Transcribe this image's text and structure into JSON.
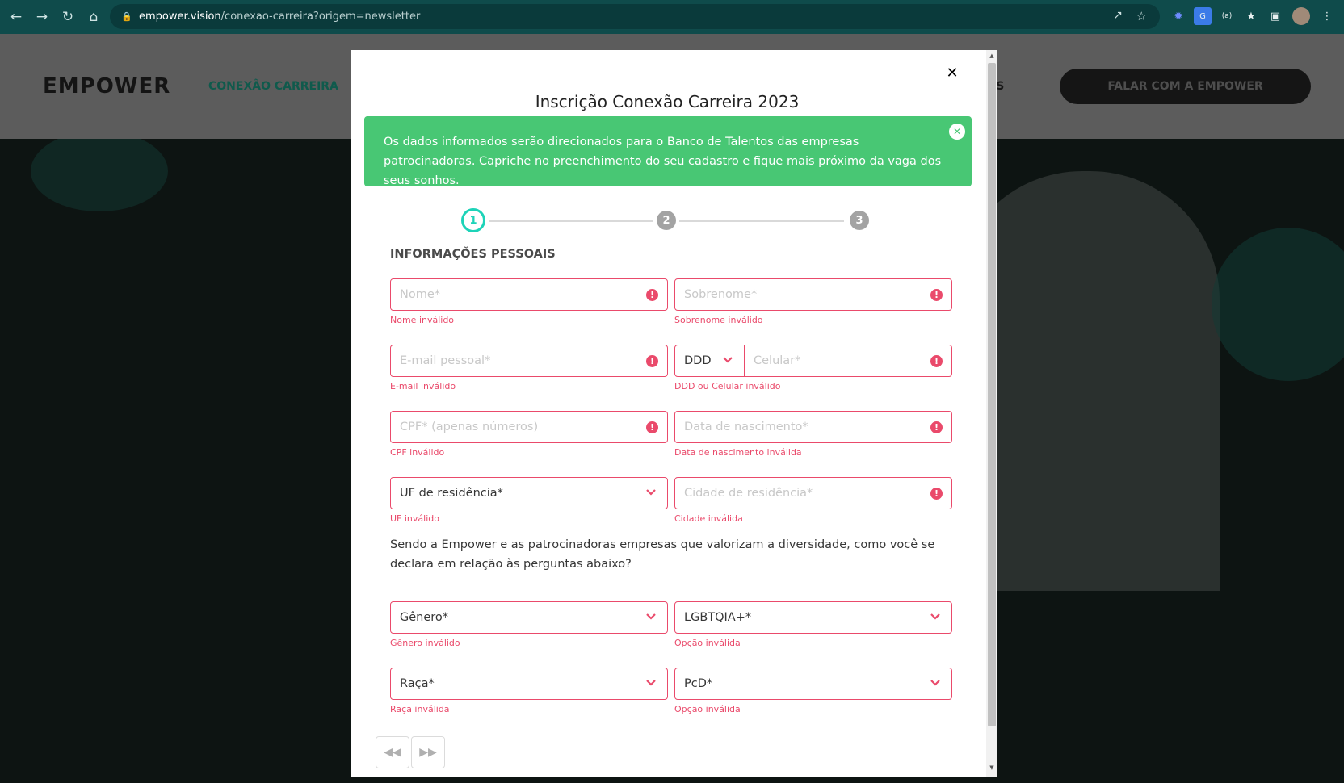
{
  "browser": {
    "url_host": "empower.vision",
    "url_path": "/conexao-carreira?origem=newsletter"
  },
  "site": {
    "logo": "EMPOWER",
    "nav_item": "CONEXÃO CARREIRA",
    "nav_item_right": "IS",
    "cta": "FALAR COM A EMPOWER"
  },
  "modal": {
    "title": "Inscrição Conexão Carreira 2023",
    "alert_text": "Os dados informados serão direcionados para o Banco de Talentos das empresas patrocinadoras. Capriche no preenchimento do seu cadastro e fique mais próximo da vaga dos seus sonhos.",
    "steps": [
      "1",
      "2",
      "3"
    ],
    "section_title": "INFORMAÇÕES PESSOAIS",
    "fields": {
      "nome": {
        "placeholder": "Nome*",
        "error": "Nome inválido"
      },
      "sobrenome": {
        "placeholder": "Sobrenome*",
        "error": "Sobrenome inválido"
      },
      "email": {
        "placeholder": "E-mail pessoal*",
        "error": "E-mail inválido"
      },
      "ddd": {
        "value": "DDD"
      },
      "celular": {
        "placeholder": "Celular*",
        "error": "DDD ou Celular inválido"
      },
      "cpf": {
        "placeholder": "CPF* (apenas números)",
        "error": "CPF inválido"
      },
      "nascimento": {
        "placeholder": "Data de nascimento*",
        "error": "Data de nascimento inválida"
      },
      "uf": {
        "value": "UF de residência*",
        "error": "UF inválido"
      },
      "cidade": {
        "placeholder": "Cidade de residência*",
        "error": "Cidade inválida"
      },
      "genero": {
        "value": "Gênero*",
        "error": "Gênero inválido"
      },
      "lgbt": {
        "value": "LGBTQIA+*",
        "error": "Opção inválida"
      },
      "raca": {
        "value": "Raça*",
        "error": "Raça inválida"
      },
      "pcd": {
        "value": "PcD*",
        "error": "Opção inválida"
      }
    },
    "diversity_question": "Sendo a Empower e as patrocinadoras empresas que valorizam a diversidade, como você se declara em relação às perguntas abaixo?",
    "error_icon": "exclamation-circle-icon",
    "accent_color": "#1dd3b8",
    "error_color": "#ea4a6b",
    "alert_color": "#48c774"
  }
}
